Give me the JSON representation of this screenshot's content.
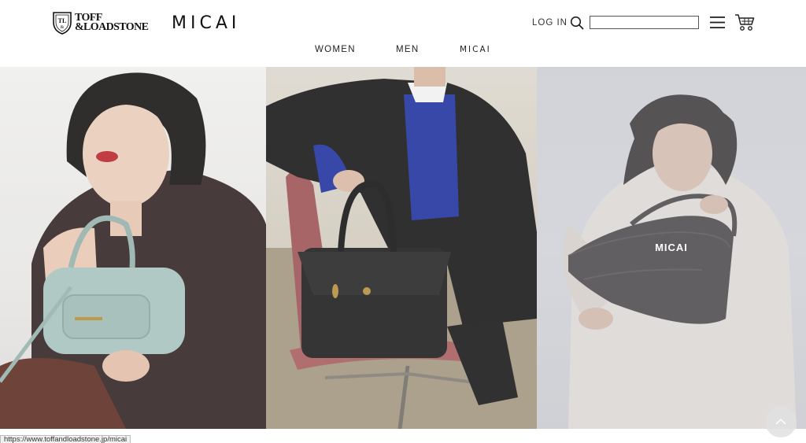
{
  "header": {
    "brand_primary_line1": "TOFF",
    "brand_primary_line2": "&LOADSTONE",
    "brand_secondary": "MICAI",
    "login_label": "LOG IN",
    "search": {
      "placeholder": "",
      "value": ""
    },
    "icons": [
      "crest-logo-icon",
      "search-icon",
      "menu-icon",
      "cart-icon"
    ]
  },
  "nav": {
    "items": [
      {
        "label": "WOMEN"
      },
      {
        "label": "MEN"
      },
      {
        "label": "MICAI"
      }
    ]
  },
  "panels": [
    {
      "label": ""
    },
    {
      "label": ""
    },
    {
      "label": "MICAI"
    }
  ],
  "status_url": "https://www.toffandloadstone.jp/micai",
  "colors": {
    "text": "#222222",
    "header_bg": "#ffffff",
    "overlay_text": "#ffffff"
  }
}
